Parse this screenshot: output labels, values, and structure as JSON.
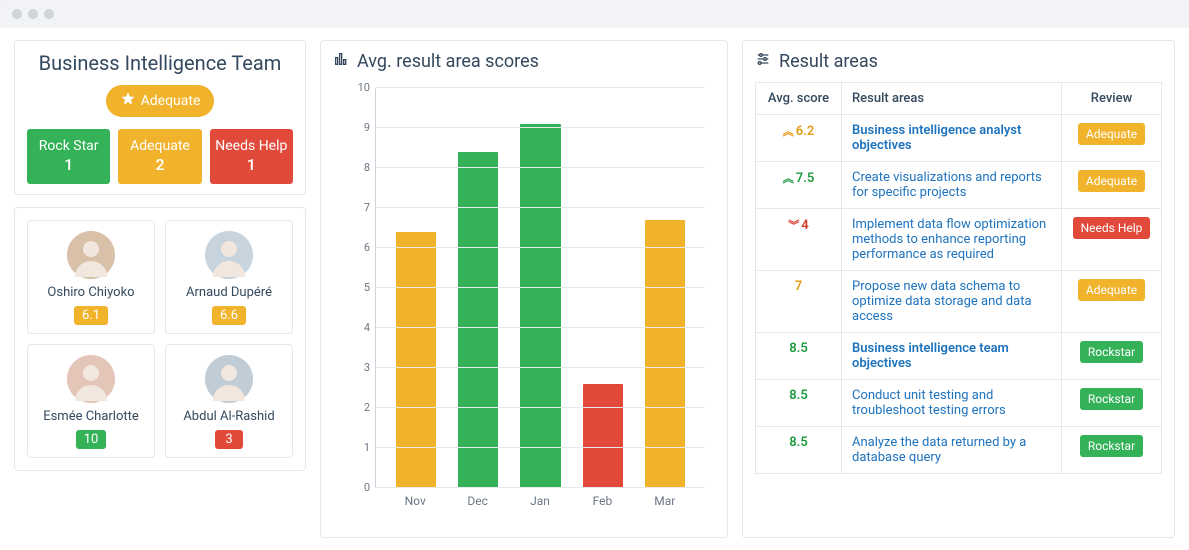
{
  "team": {
    "name": "Business Intelligence Team",
    "overall_badge": "Adequate",
    "statuses": [
      {
        "label": "Rock Star",
        "count": "1",
        "color": "green"
      },
      {
        "label": "Adequate",
        "count": "2",
        "color": "orange"
      },
      {
        "label": "Needs Help",
        "count": "1",
        "color": "red"
      }
    ]
  },
  "people": [
    {
      "name": "Oshiro Chiyoko",
      "score": "6.1",
      "score_color": "orange"
    },
    {
      "name": "Arnaud Dupéré",
      "score": "6.6",
      "score_color": "orange"
    },
    {
      "name": "Esmée Charlotte",
      "score": "10",
      "score_color": "green"
    },
    {
      "name": "Abdul Al-Rashid",
      "score": "3",
      "score_color": "red"
    }
  ],
  "chart_title": "Avg. result area scores",
  "chart_data": {
    "type": "bar",
    "title": "Avg. result area scores",
    "categories": [
      "Nov",
      "Dec",
      "Jan",
      "Feb",
      "Mar"
    ],
    "values": [
      6.4,
      8.4,
      9.1,
      2.6,
      6.7
    ],
    "colors": [
      "orange",
      "green",
      "green",
      "red",
      "orange"
    ],
    "xlabel": "",
    "ylabel": "",
    "ylim": [
      0,
      10
    ],
    "yticks": [
      0,
      1,
      2,
      3,
      4,
      5,
      6,
      7,
      8,
      9,
      10
    ]
  },
  "result_areas_title": "Result areas",
  "table": {
    "headers": {
      "score": "Avg. score",
      "area": "Result areas",
      "review": "Review"
    },
    "rows": [
      {
        "score": "6.2",
        "score_color": "score-orange",
        "arrow": "up",
        "area": "Business intelligence analyst objectives",
        "bold": true,
        "review": "Adequate",
        "review_color": "orange"
      },
      {
        "score": "7.5",
        "score_color": "score-green",
        "arrow": "up",
        "area": "Create visualizations and reports for specific projects",
        "bold": false,
        "review": "Adequate",
        "review_color": "orange"
      },
      {
        "score": "4",
        "score_color": "score-red",
        "arrow": "down",
        "area": "Implement data flow optimization methods to enhance reporting performance as required",
        "bold": false,
        "review": "Needs Help",
        "review_color": "red"
      },
      {
        "score": "7",
        "score_color": "score-orange",
        "arrow": "",
        "area": "Propose new data schema to optimize data storage and data access",
        "bold": false,
        "review": "Adequate",
        "review_color": "orange"
      },
      {
        "score": "8.5",
        "score_color": "score-green",
        "arrow": "",
        "area": "Business intelligence team objectives",
        "bold": true,
        "review": "Rockstar",
        "review_color": "green"
      },
      {
        "score": "8.5",
        "score_color": "score-green",
        "arrow": "",
        "area": "Conduct unit testing and troubleshoot testing errors",
        "bold": false,
        "review": "Rockstar",
        "review_color": "green"
      },
      {
        "score": "8.5",
        "score_color": "score-green",
        "arrow": "",
        "area": "Analyze the data returned by a database query",
        "bold": false,
        "review": "Rockstar",
        "review_color": "green"
      }
    ]
  },
  "colors": {
    "green": "#34b257",
    "orange": "#f1b32c",
    "red": "#e14a3b"
  }
}
